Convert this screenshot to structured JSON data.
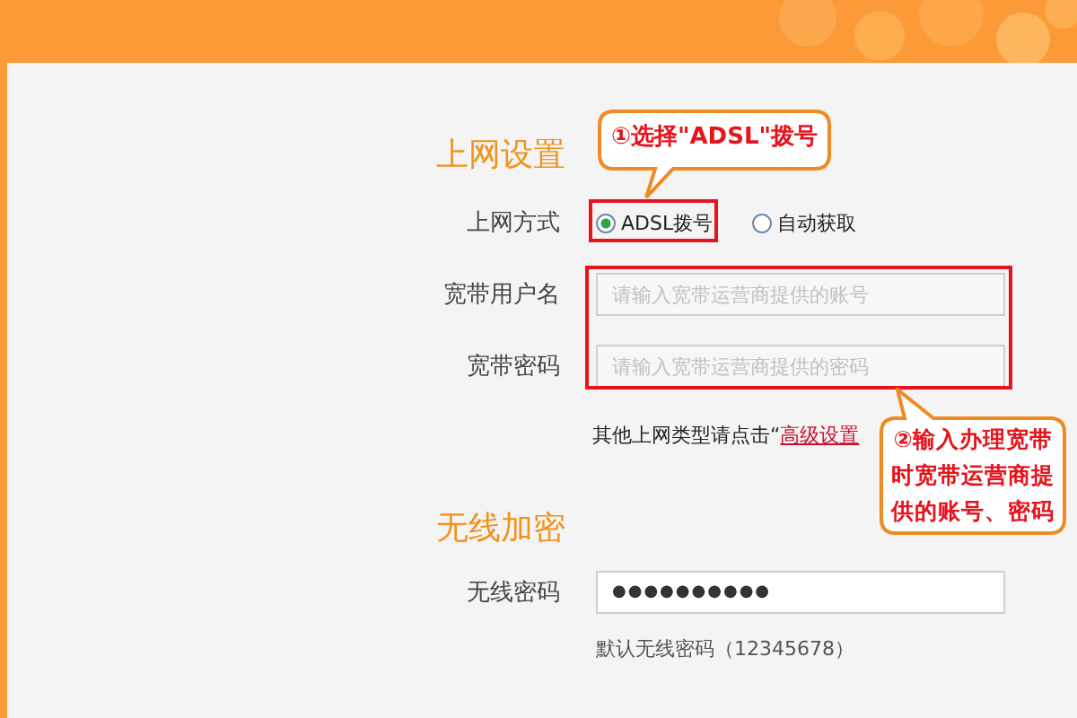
{
  "sections": [
    {
      "title": "上网设置",
      "rows": [
        {
          "kind": "radios",
          "label": "上网方式",
          "options": [
            {
              "label": "ADSL拨号",
              "selected": true
            },
            {
              "label": "自动获取",
              "selected": false
            }
          ]
        },
        {
          "kind": "field",
          "label": "宽带用户名",
          "placeholder": "请输入宽带运营商提供的账号"
        },
        {
          "kind": "field",
          "label": "宽带密码",
          "placeholder": "请输入宽带运营商提供的密码"
        },
        {
          "kind": "link",
          "text": "其他上网类型请点击“",
          "link": "高级设置"
        }
      ]
    },
    {
      "title": "无线加密",
      "rows": [
        {
          "kind": "password",
          "label": "无线密码",
          "value": "●●●●●●●●●●"
        },
        {
          "kind": "hint",
          "text": "默认无线密码（12345678）"
        }
      ]
    }
  ],
  "annotations": [
    {
      "kind": "callout-down",
      "lines": [
        "①选择\"ADSL\"拨号"
      ]
    },
    {
      "kind": "callout-up",
      "lines": [
        "②输入办理宽带",
        "时宽带运营商提",
        "供的账号、密码"
      ]
    }
  ]
}
